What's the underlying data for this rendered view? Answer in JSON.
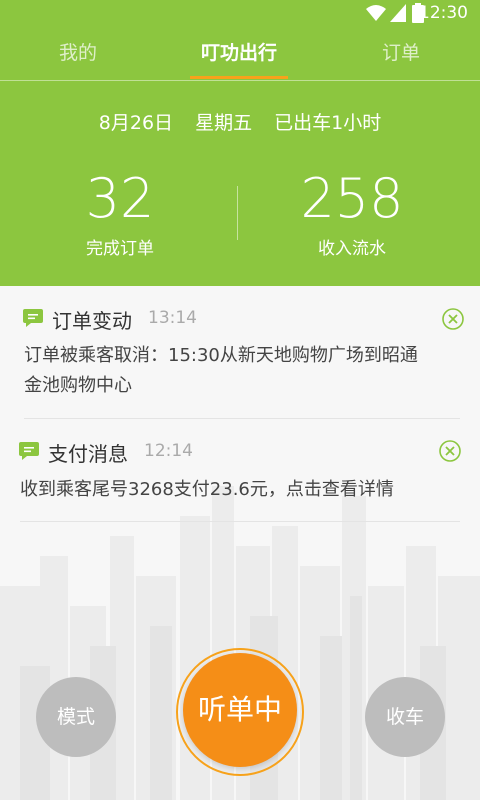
{
  "status_bar": {
    "time": "12:30"
  },
  "tabs": [
    {
      "label": "我的"
    },
    {
      "label": "叮功出行"
    },
    {
      "label": "订单"
    }
  ],
  "header": {
    "date": "8月26日",
    "weekday": "星期五",
    "duration": "已出车1小时"
  },
  "stats": [
    {
      "value": "32",
      "label": "完成订单"
    },
    {
      "value": "258",
      "label": "收入流水"
    }
  ],
  "notifications": [
    {
      "title": "订单变动",
      "time": "13:14",
      "message_line1": "订单被乘客取消：15:30从新天地购物广场到昭通",
      "message_line2": "金池购物中心"
    },
    {
      "title": "支付消息",
      "time": "12:14",
      "message_line1": "收到乘客尾号3268支付23.6元，点击查看详情"
    }
  ],
  "buttons": {
    "mode": "模式",
    "listening": "听单中",
    "stop": "收车"
  },
  "colors": {
    "brand_green": "#8cc63f",
    "accent_orange": "#f58e17",
    "side_button_gray": "#bdbdbd"
  }
}
